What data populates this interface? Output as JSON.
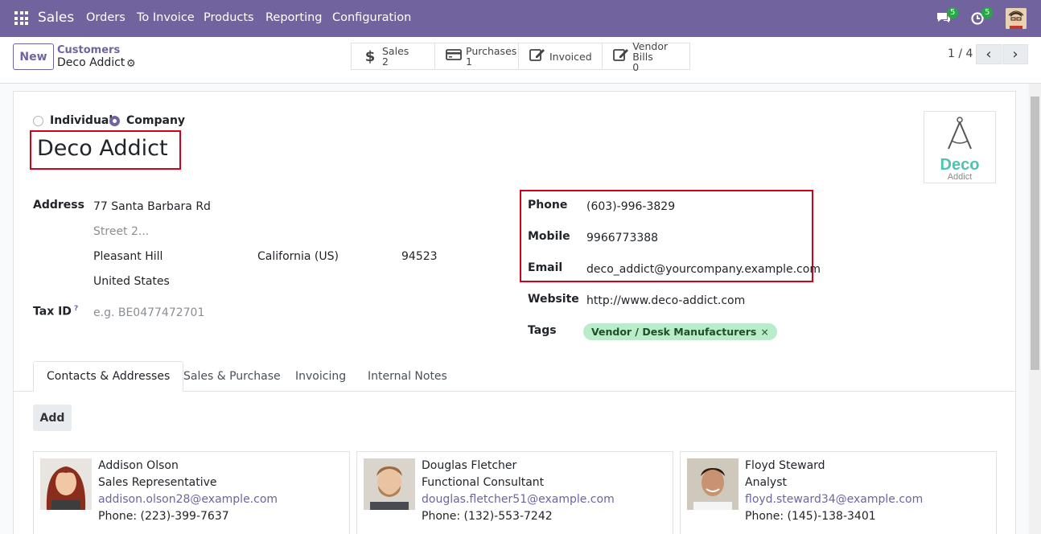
{
  "navbar": {
    "brand": "Sales",
    "menu": [
      "Orders",
      "To Invoice",
      "Products",
      "Reporting",
      "Configuration"
    ],
    "messages_count": "5",
    "activities_count": "5"
  },
  "control": {
    "new_label": "New",
    "breadcrumb_parent": "Customers",
    "breadcrumb_current": "Deco Addict",
    "stats": [
      {
        "label": "Sales",
        "value": "2",
        "icon": "dollar-icon"
      },
      {
        "label": "Purchases",
        "value": "1",
        "icon": "credit-card-icon"
      },
      {
        "label": "Invoiced",
        "value": "",
        "icon": "edit-icon"
      },
      {
        "label": "Vendor Bills",
        "value": "0",
        "icon": "edit-icon"
      }
    ],
    "pager": "1 / 4"
  },
  "form": {
    "type_individual": "Individual",
    "type_company": "Company",
    "selected_type": "Company",
    "name": "Deco Addict",
    "logo_text_top": "Deco",
    "logo_text_bottom": "Addict",
    "address_label": "Address",
    "street": "77 Santa Barbara Rd",
    "street2_placeholder": "Street 2...",
    "city": "Pleasant Hill",
    "state": "California (US)",
    "zip": "94523",
    "country": "United States",
    "taxid_label": "Tax ID",
    "taxid_help": "?",
    "taxid_placeholder": "e.g. BE0477472701",
    "phone_label": "Phone",
    "phone": "(603)-996-3829",
    "mobile_label": "Mobile",
    "mobile": "9966773388",
    "email_label": "Email",
    "email": "deco_addict@yourcompany.example.com",
    "website_label": "Website",
    "website": "http://www.deco-addict.com",
    "tags_label": "Tags",
    "tag": "Vendor / Desk Manufacturers",
    "tag_remove": "×"
  },
  "tabs": [
    "Contacts & Addresses",
    "Sales & Purchase",
    "Invoicing",
    "Internal Notes"
  ],
  "contacts": {
    "add_label": "Add",
    "cards": [
      {
        "name": "Addison Olson",
        "title": "Sales Representative",
        "email": "addison.olson28@example.com",
        "phone": "Phone: (223)-399-7637"
      },
      {
        "name": "Douglas Fletcher",
        "title": "Functional Consultant",
        "email": "douglas.fletcher51@example.com",
        "phone": "Phone: (132)-553-7242"
      },
      {
        "name": "Floyd Steward",
        "title": "Analyst",
        "email": "floyd.steward34@example.com",
        "phone": "Phone: (145)-138-3401"
      }
    ]
  },
  "colors": {
    "brand": "#71639e",
    "highlight": "#d0021b",
    "tag_bg": "#b9ecc8",
    "logo_teal": "#4fc3b0"
  }
}
